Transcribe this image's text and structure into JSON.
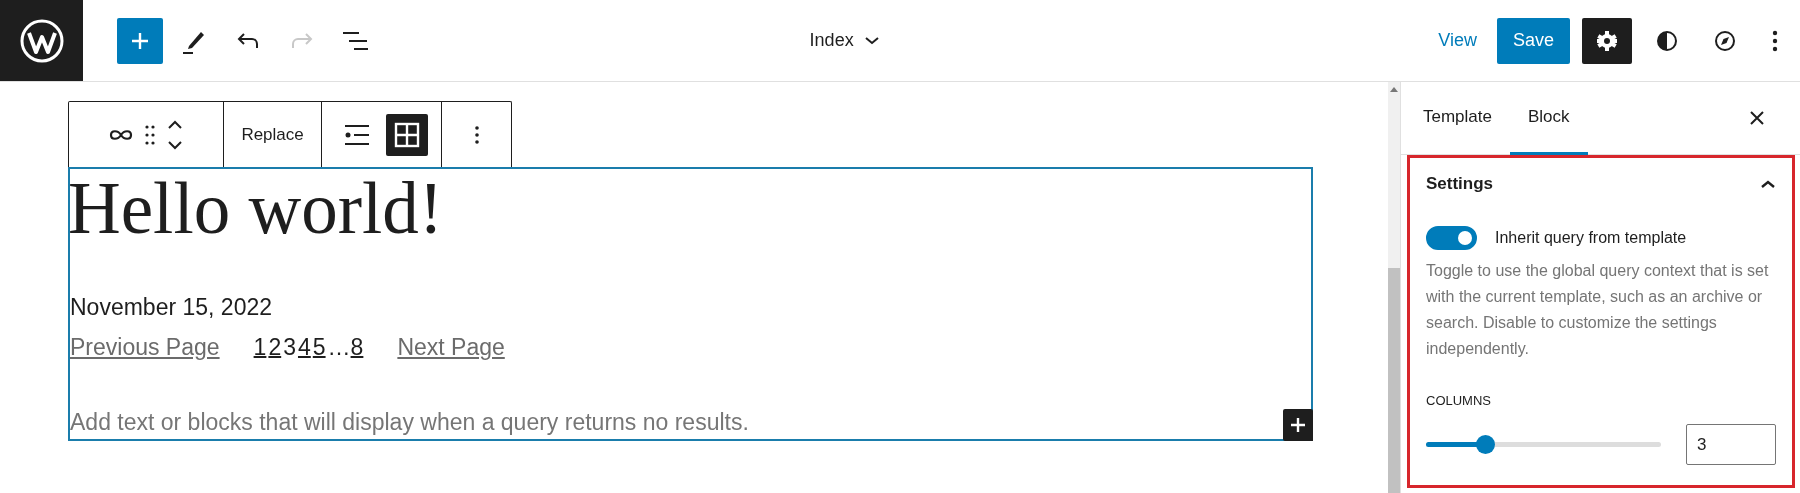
{
  "top_bar": {
    "inserter_open": false,
    "redo_disabled": true,
    "document_title": "Index",
    "view_link": "View",
    "save_button": "Save",
    "settings_open": true
  },
  "block_toolbar": {
    "replace_button": "Replace",
    "views": [
      {
        "kind": "list",
        "selected": false
      },
      {
        "kind": "grid",
        "selected": true
      }
    ]
  },
  "query_block": {
    "heading": "Hello world!",
    "date": "November 15, 2022",
    "pagination": {
      "previous": "Previous Page",
      "next": "Next Page",
      "pages": [
        {
          "label": "1",
          "kind": "page",
          "selected": false
        },
        {
          "label": "2",
          "kind": "page",
          "selected": false
        },
        {
          "label": "3",
          "kind": "page",
          "selected": true
        },
        {
          "label": "4",
          "kind": "page",
          "selected": false
        },
        {
          "label": "5",
          "kind": "page",
          "selected": false
        },
        {
          "label": "…",
          "kind": "dots"
        },
        {
          "label": "8",
          "kind": "page",
          "selected": false
        }
      ]
    },
    "no_results_placeholder": "Add text or blocks that will display when a query returns no results."
  },
  "sidebar": {
    "tabs": [
      {
        "label": "Template",
        "selected": false
      },
      {
        "label": "Block",
        "selected": true
      }
    ],
    "panel": {
      "title": "Settings",
      "expanded": true,
      "highlighted": true,
      "toggle": {
        "label": "Inherit query from template",
        "on": true
      },
      "help": "Toggle to use the global query context that is set with the current template, such as an archive or search. Disable to customize the settings independently.",
      "columns": {
        "label": "COLUMNS",
        "level": 0.25,
        "value": "3"
      }
    }
  }
}
